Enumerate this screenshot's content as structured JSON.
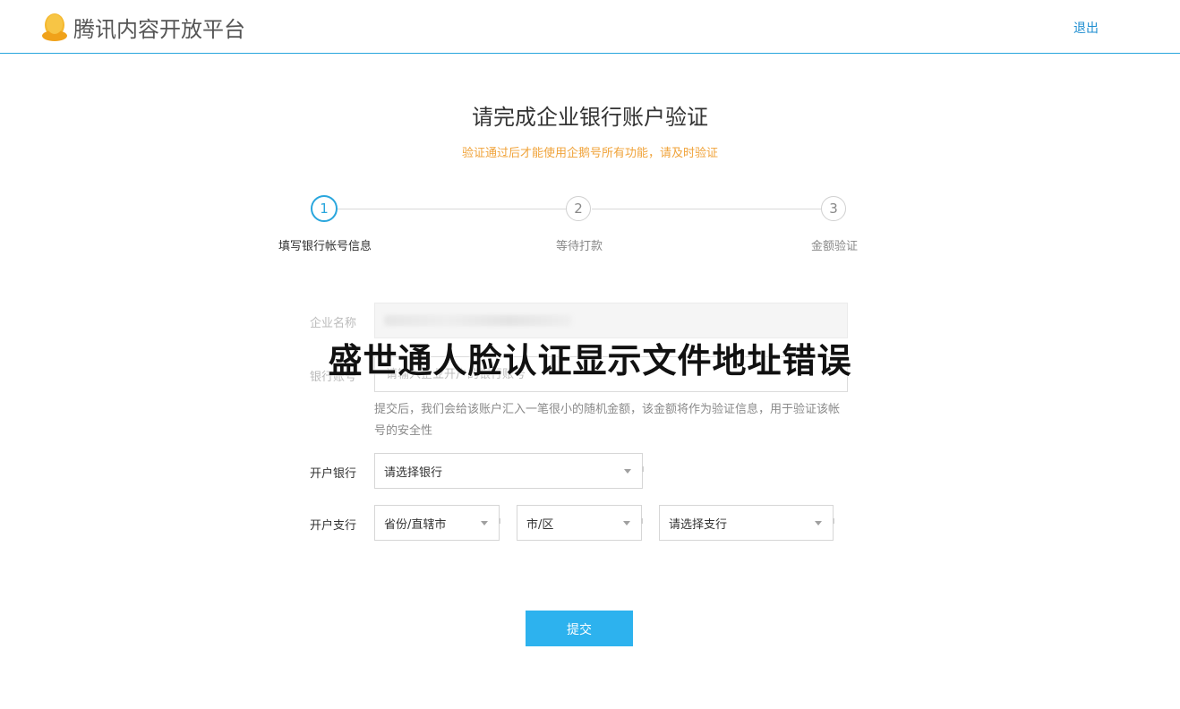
{
  "header": {
    "logo_text": "腾讯内容开放平台",
    "logout_label": "退出",
    "logo_color": "#f5b82e",
    "accent_color": "#29a6dd"
  },
  "main": {
    "title": "请完成企业银行账户验证",
    "subtitle": "验证通过后才能使用企鹅号所有功能，请及时验证"
  },
  "steps": [
    {
      "number": "1",
      "label": "填写银行帐号信息",
      "active": true
    },
    {
      "number": "2",
      "label": "等待打款",
      "active": false
    },
    {
      "number": "3",
      "label": "金额验证",
      "active": false
    }
  ],
  "form": {
    "company_label": "企业名称",
    "account_label": "银行账号",
    "account_placeholder": "请输入企业开户的银行账号",
    "account_hint": "提交后，我们会给该账户汇入一笔很小的随机金额，该金额将作为验证信息，用于验证该帐号的安全性",
    "bank_label": "开户银行",
    "bank_select": "请选择银行",
    "branch_label": "开户支行",
    "province_select": "省份/直辖市",
    "city_select": "市/区",
    "branch_select": "请选择支行",
    "submit_label": "提交"
  },
  "overlay": {
    "title": "盛世通人脸认证显示文件地址错误"
  }
}
